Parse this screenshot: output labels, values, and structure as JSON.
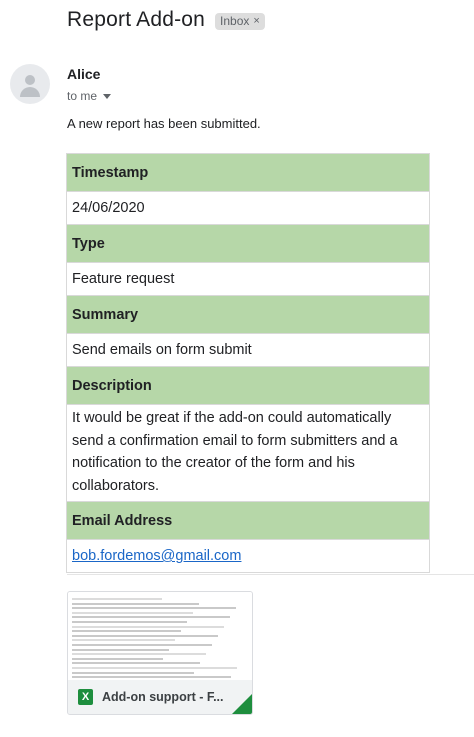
{
  "email": {
    "subject": "Report Add-on",
    "label_badge": "Inbox",
    "label_remove_glyph": "×",
    "sender_name": "Alice",
    "recipient": "to me",
    "intro_text": "A new report has been submitted."
  },
  "report": {
    "rows": [
      {
        "header": "Timestamp",
        "value": "24/06/2020"
      },
      {
        "header": "Type",
        "value": "Feature request"
      },
      {
        "header": "Summary",
        "value": "Send emails on form submit"
      },
      {
        "header": "Description",
        "value": "It would be great if the add-on could automatically send a confirmation email to form submitters and a notification to the creator of the form and his collaborators."
      },
      {
        "header": "Email Address",
        "value": "bob.fordemos@gmail.com"
      }
    ]
  },
  "attachment": {
    "name": "Add-on support - F...",
    "icon": "excel-icon",
    "icon_letter": "X"
  },
  "colors": {
    "header_bg": "#b6d7a8",
    "link": "#1a66c7",
    "excel_green": "#1e8e3e"
  }
}
